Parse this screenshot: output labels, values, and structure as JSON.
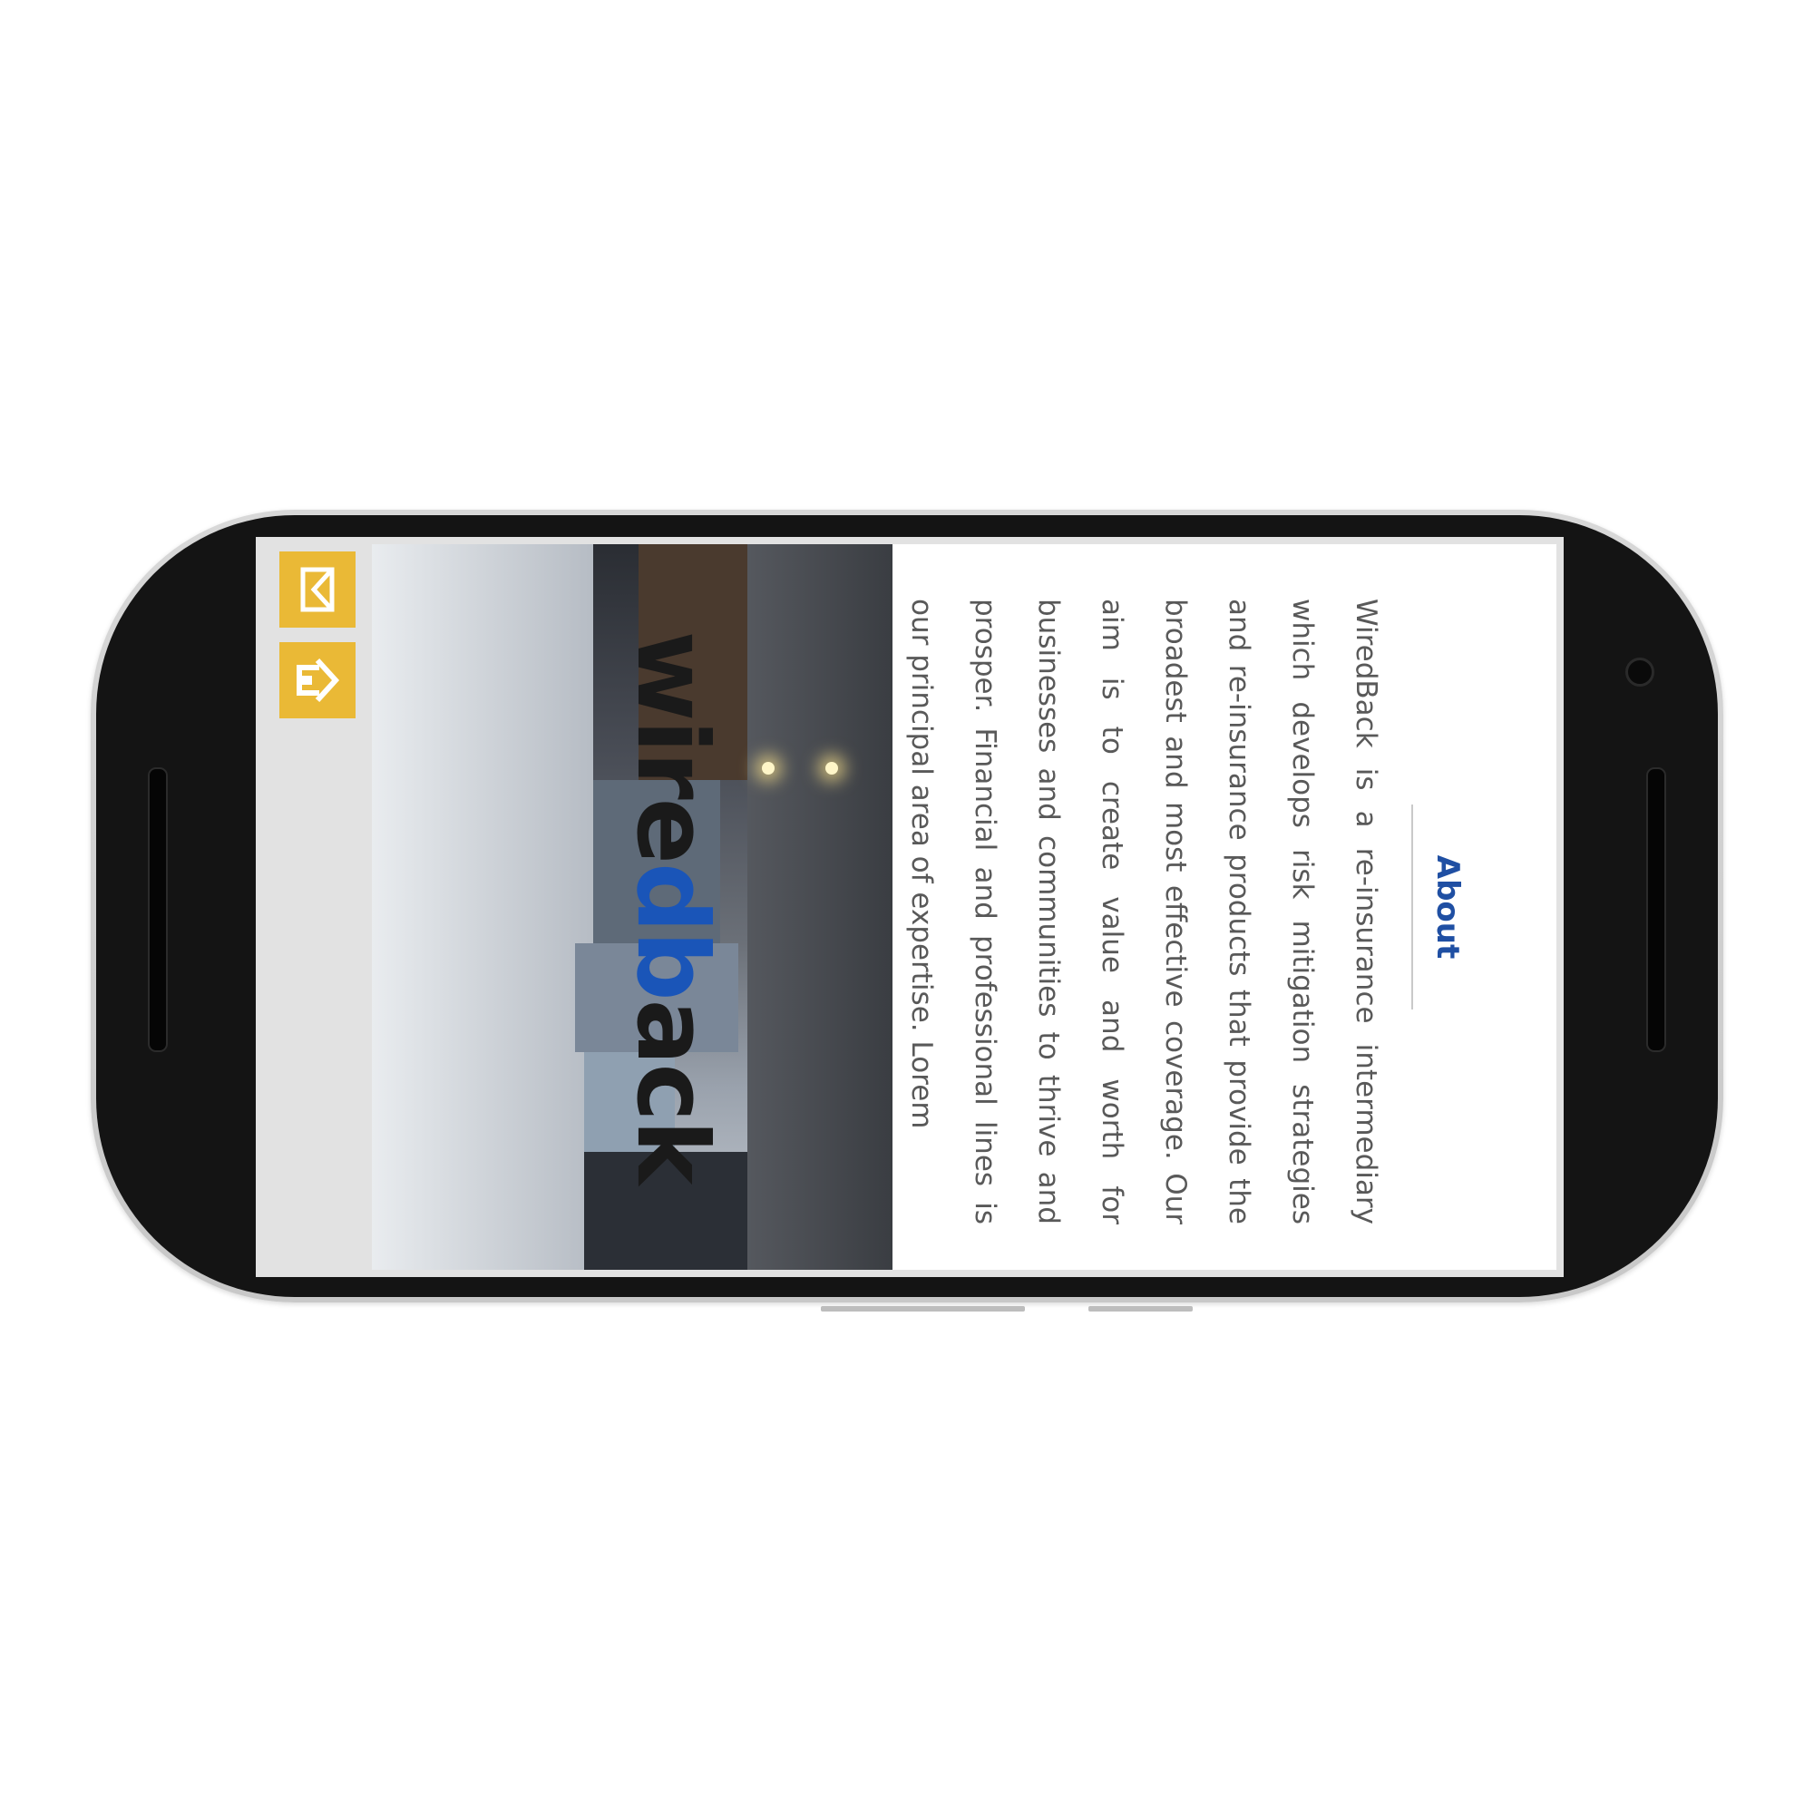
{
  "app": {
    "brand": {
      "part1": "wire",
      "part2": "db",
      "part3": "ack"
    },
    "about": {
      "title": "About",
      "body": "WiredBack is a re-insurance intermediary which develops risk mitigation strategies and re-insurance products that provide the broadest and most effective coverage. Our aim is to create value and worth for businesses and communities to thrive and prosper. Financial and professional lines is our principal area of expertise. Lorem"
    },
    "actions": {
      "home_icon": "home-icon",
      "mail_icon": "mail-icon"
    },
    "colors": {
      "accent": "#eab936",
      "brand_blue": "#1f4fa3",
      "text": "#595959"
    }
  }
}
